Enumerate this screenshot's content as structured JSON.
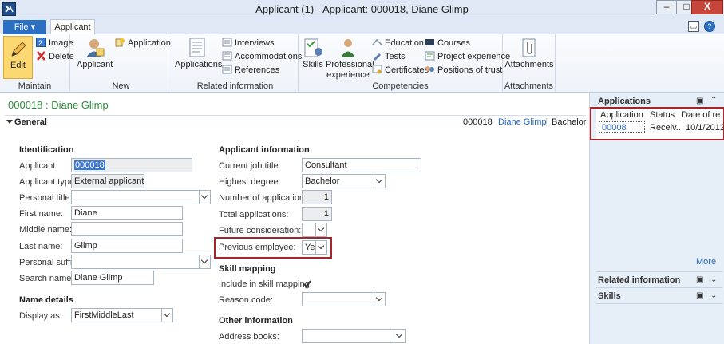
{
  "window": {
    "title": "Applicant (1) - Applicant: 000018, Diane Glimp",
    "app_icon": "Dynamics AX",
    "min_label": "–",
    "max_label": "□",
    "close_label": "X"
  },
  "tabs": {
    "file": "File",
    "file_arrow": "▾",
    "applicant": "Applicant"
  },
  "ribbon": {
    "maintain": {
      "label": "Maintain",
      "edit": "Edit",
      "image": "Image",
      "delete": "Delete"
    },
    "new": {
      "label": "New",
      "applicant": "Applicant",
      "application": "Application"
    },
    "related": {
      "label": "Related information",
      "applications": "Applications",
      "interviews": "Interviews",
      "accommodations": "Accommodations",
      "references": "References"
    },
    "competencies": {
      "label": "Competencies",
      "skills": "Skills",
      "professional_experience_1": "Professional",
      "professional_experience_2": "experience",
      "education": "Education",
      "tests": "Tests",
      "certificates": "Certificates",
      "courses": "Courses",
      "project_experience": "Project experience",
      "positions_of_trust": "Positions of trust"
    },
    "attachments": {
      "label": "Attachments",
      "attachments": "Attachments"
    }
  },
  "record": {
    "header": "000018 : Diane Glimp",
    "section": "General",
    "summary": {
      "id": "000018",
      "name": "Diane Glimp",
      "degree": "Bachelor"
    }
  },
  "identification": {
    "title": "Identification",
    "applicant_label": "Applicant:",
    "applicant_value": "000018",
    "type_label": "Applicant type:",
    "type_value": "External applicant",
    "personal_title_label": "Personal title:",
    "personal_title_value": "",
    "first_name_label": "First name:",
    "first_name_value": "Diane",
    "middle_name_label": "Middle name:",
    "middle_name_value": "",
    "last_name_label": "Last name:",
    "last_name_value": "Glimp",
    "suffix_label": "Personal suffix:",
    "suffix_value": "",
    "search_name_label": "Search name:",
    "search_name_value": "Diane Glimp"
  },
  "name_details": {
    "title": "Name details",
    "display_as_label": "Display as:",
    "display_as_value": "FirstMiddleLast"
  },
  "applicant_info": {
    "title": "Applicant information",
    "job_title_label": "Current job title:",
    "job_title_value": "Consultant",
    "degree_label": "Highest degree:",
    "degree_value": "Bachelor",
    "num_apps_label": "Number of applications:",
    "num_apps_value": "1",
    "total_apps_label": "Total applications:",
    "total_apps_value": "1",
    "future_label": "Future consideration:",
    "future_value": "",
    "prev_emp_label": "Previous employee:",
    "prev_emp_value": "Yes"
  },
  "skill_mapping": {
    "title": "Skill mapping",
    "include_label": "Include in skill mapping:",
    "include_checked": true,
    "reason_label": "Reason code:",
    "reason_value": ""
  },
  "other_info": {
    "title": "Other information",
    "address_books_label": "Address books:",
    "address_books_value": ""
  },
  "factbox": {
    "applications_title": "Applications",
    "columns": [
      "Application",
      "Status",
      "Date of re"
    ],
    "row": {
      "application": "00008",
      "status": "Receiv...",
      "date": "10/1/2012"
    },
    "more": "More",
    "related_title": "Related information",
    "skills_title": "Skills"
  },
  "colors": {
    "accent_red": "#a8242b",
    "link_blue": "#2a69c3",
    "record_green": "#2e8c3a"
  }
}
